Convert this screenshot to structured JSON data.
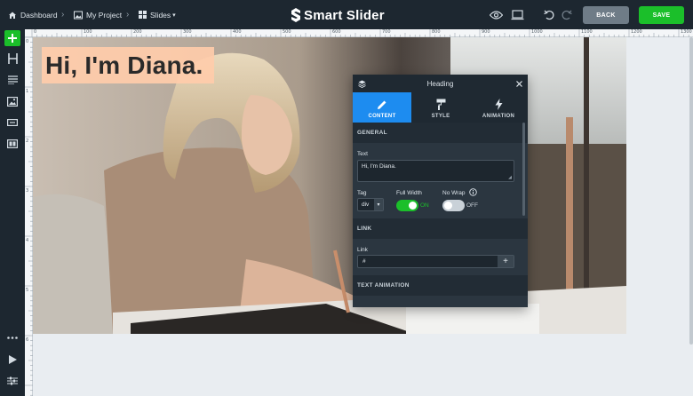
{
  "breadcrumbs": {
    "dashboard": "Dashboard",
    "project": "My Project",
    "slides": "Slides"
  },
  "brand": "Smart Slider",
  "actions": {
    "back": "BACK",
    "save": "SAVE"
  },
  "ruler": {
    "top": [
      "0",
      "100",
      "200",
      "300",
      "400",
      "500",
      "600",
      "700",
      "800",
      "900",
      "1000",
      "1100",
      "1200",
      "1300"
    ],
    "left": [
      "0",
      "1",
      "2",
      "3",
      "4",
      "5",
      "6"
    ]
  },
  "canvas": {
    "heading_text": "Hi, I'm Diana."
  },
  "panel": {
    "title": "Heading",
    "tabs": [
      "CONTENT",
      "STYLE",
      "ANIMATION"
    ],
    "general_section": "GENERAL",
    "text_label": "Text",
    "text_value": "Hi, I'm Diana.",
    "tag_label": "Tag",
    "tag_value": "div",
    "full_width_label": "Full Width",
    "full_width_state": "ON",
    "no_wrap_label": "No Wrap",
    "no_wrap_state": "OFF",
    "link_section": "LINK",
    "link_label": "Link",
    "link_value": "#",
    "text_animation_section": "TEXT ANIMATION"
  },
  "colors": {
    "accent": "#1d8cf0",
    "save": "#1bbf2a",
    "dark": "#1d2730"
  }
}
